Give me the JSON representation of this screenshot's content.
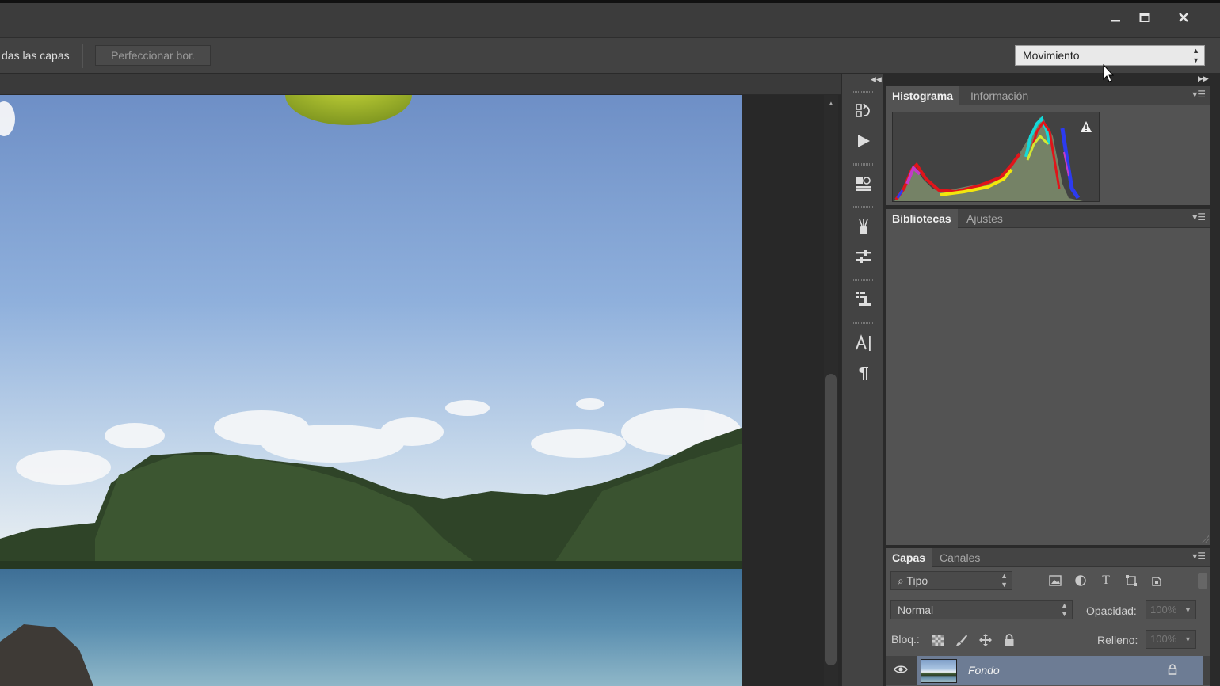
{
  "window": {
    "minimize_icon": "minimize-icon",
    "maximize_icon": "maximize-icon",
    "close_icon": "close-icon"
  },
  "options_bar": {
    "sample_all_layers_text": "das las capas",
    "refine_edge_button": "Perfeccionar bor.",
    "workspace_selected": "Movimiento"
  },
  "dock_icons": [
    "history-icon",
    "play-actions-icon",
    "properties-icon",
    "brush-presets-icon",
    "tool-presets-icon",
    "clone-source-icon",
    "character-icon",
    "paragraph-icon"
  ],
  "histogram_panel": {
    "tabs": [
      {
        "label": "Histograma",
        "active": true
      },
      {
        "label": "Información",
        "active": false
      }
    ],
    "warning_icon": "warning-icon"
  },
  "libraries_panel": {
    "tabs": [
      {
        "label": "Bibliotecas",
        "active": true
      },
      {
        "label": "Ajustes",
        "active": false
      }
    ]
  },
  "layers_panel": {
    "tabs": [
      {
        "label": "Capas",
        "active": true
      },
      {
        "label": "Canales",
        "active": false
      }
    ],
    "filter_kind": "Tipo",
    "blend_mode": "Normal",
    "opacity_label": "Opacidad:",
    "opacity_value": "100%",
    "lock_label": "Bloq.:",
    "fill_label": "Relleno:",
    "fill_value": "100%",
    "layers": [
      {
        "name": "Fondo",
        "visible": true,
        "locked": true
      }
    ]
  },
  "colors": {
    "panel_bg": "#535353",
    "selected_layer": "#6d7c94"
  }
}
